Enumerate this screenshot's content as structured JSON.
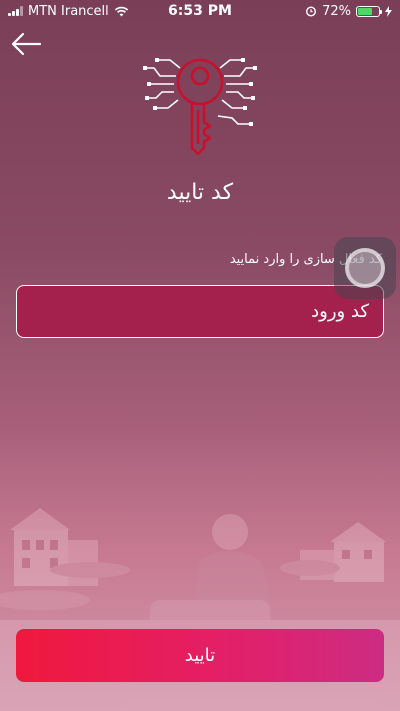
{
  "status_bar": {
    "carrier": "MTN Irancell",
    "time": "6:53 PM",
    "battery_percent": "72%",
    "battery_level": 0.72
  },
  "header": {
    "back_icon": "arrow-left-icon",
    "illustration_icon": "circuit-key-icon"
  },
  "main": {
    "title": "کد تایید",
    "instruction": "کد فعال سازی را وارد نمایید",
    "code_input": {
      "placeholder": "کد ورود",
      "value": ""
    },
    "confirm_label": "تایید"
  },
  "colors": {
    "background_top": "#7a3f57",
    "input_fill": "#a4214d",
    "button_gradient_start": "#f0183d",
    "button_gradient_end": "#cc2c83",
    "key_red": "#c8102e"
  }
}
